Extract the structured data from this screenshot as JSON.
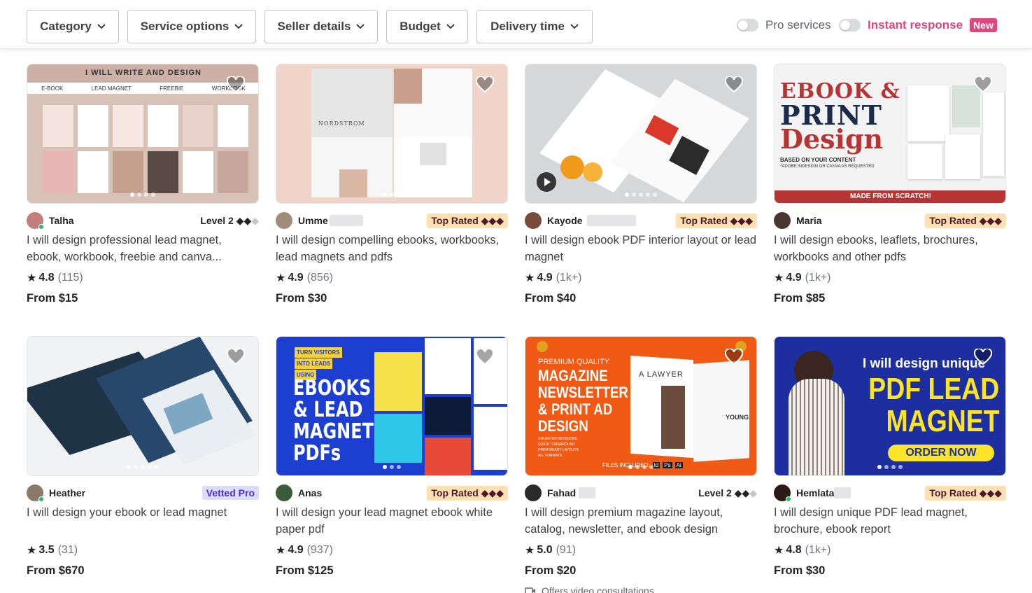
{
  "filters": {
    "category": "Category",
    "service_options": "Service options",
    "seller_details": "Seller details",
    "budget": "Budget",
    "delivery_time": "Delivery time",
    "pro_services": "Pro services",
    "instant_response": "Instant response",
    "new_badge": "New"
  },
  "cards": [
    {
      "seller": "Talha",
      "badge": "Level 2",
      "badge_type": "level",
      "title": "I will design professional lead magnet, ebook, workbook, freebie and canva...",
      "rating": "4.8",
      "reviews": "(115)",
      "price": "From $15",
      "image_text": "I WILL WRITE AND DESIGN",
      "image_tabs": [
        "E-BOOK",
        "LEAD MAGNET",
        "FREEBIE",
        "WORKBOOK"
      ]
    },
    {
      "seller": "Umme",
      "badge": "Top Rated",
      "badge_type": "top",
      "title": "I will design compelling ebooks, workbooks, lead magnets and pdfs",
      "rating": "4.9",
      "reviews": "(856)",
      "price": "From $30",
      "image_text": "NORDSTROM"
    },
    {
      "seller": "Kayode",
      "badge": "Top Rated",
      "badge_type": "top",
      "title": "I will design ebook PDF interior layout or lead magnet",
      "rating": "4.9",
      "reviews": "(1k+)",
      "price": "From $40"
    },
    {
      "seller": "Maria",
      "badge": "Top Rated",
      "badge_type": "top",
      "title": "I will design ebooks, leaflets, brochures, workbooks and other pdfs",
      "rating": "4.9",
      "reviews": "(1k+)",
      "price": "From $85",
      "image_text": [
        "EBOOK &",
        "PRINT",
        "Design"
      ],
      "image_sub": "BASED ON YOUR CONTENT",
      "image_sub2": "*ADOBE INDESIGN OR CANVA AS REQUESTED",
      "image_footer": "MADE FROM SCRATCH!"
    },
    {
      "seller": "Heather",
      "badge": "Vetted Pro",
      "badge_type": "pro",
      "title": "I will design your ebook or lead magnet",
      "rating": "3.5",
      "reviews": "(31)",
      "price": "From $670"
    },
    {
      "seller": "Anas",
      "badge": "Top Rated",
      "badge_type": "top",
      "title": "I will design your lead magnet ebook white paper pdf",
      "rating": "4.9",
      "reviews": "(937)",
      "price": "From $125",
      "image_tags": [
        "TURN VISITORS",
        "INTO LEADS",
        "USING"
      ],
      "image_text": [
        "EBOOKS",
        "& LEAD",
        "MAGNET",
        "PDFs"
      ]
    },
    {
      "seller": "Fahad",
      "badge": "Level 2",
      "badge_type": "level",
      "title": "I will design premium magazine layout, catalog, newsletter, and ebook design",
      "rating": "5.0",
      "reviews": "(91)",
      "price": "From $20",
      "extra": "Offers video consultations",
      "image_pre": "PREMIUM QUALITY",
      "image_text": [
        "MAGAZINE",
        "NEWSLETTER",
        "& PRINT AD",
        "DESIGN"
      ],
      "image_list": [
        "UNLIMITED REVISIONS",
        "QUICK TURNAROUND",
        "PRINT-READY LAYOUTS",
        "ALL FORMATS"
      ],
      "image_files": "FILES INCLUDED:",
      "image_files_icons": [
        "Id",
        "Ps",
        "Ai"
      ],
      "image_spread": [
        "A LAWYER",
        "YOUNG"
      ]
    },
    {
      "seller": "Hemlata",
      "badge": "Top Rated",
      "badge_type": "top",
      "title": "I will design unique PDF lead magnet, brochure, ebook report",
      "rating": "4.8",
      "reviews": "(1k+)",
      "price": "From $30",
      "image_top": "I will design unique",
      "image_text": [
        "PDF LEAD",
        "MAGNET"
      ],
      "image_cta": "ORDER NOW"
    }
  ],
  "colors": {
    "accent_pink": "#e2467e",
    "top_rated_bg": "#ffe0b3",
    "vetted_pro_bg": "#dcdcfc",
    "online": "#1dbf73"
  }
}
